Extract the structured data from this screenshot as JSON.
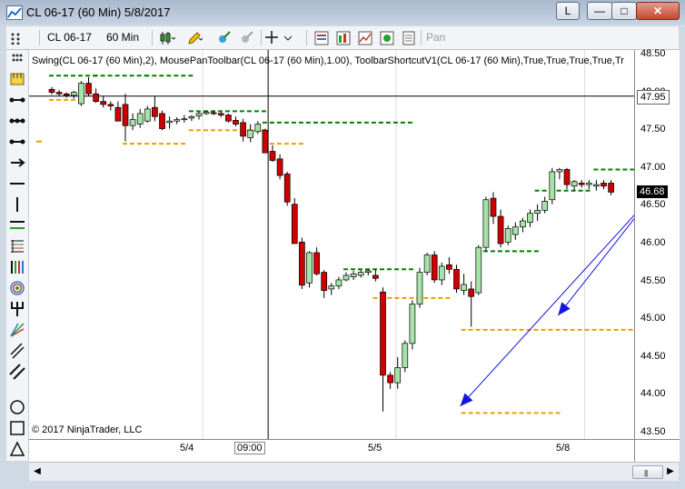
{
  "window": {
    "title": "CL 06-17 (60 Min)  5/8/2017",
    "link_button": "L",
    "minimize_button": "—",
    "maximize_button": "□",
    "close_button": "✕"
  },
  "toolbar": {
    "instrument": "CL 06-17",
    "period": "60 Min",
    "pan_label": "Pan",
    "icons": [
      "grip-icon",
      "candlestick-style-icon",
      "pencil-icon",
      "crosshair-icon",
      "zoom-icon",
      "properties-icon",
      "bar-chart-icon",
      "line-chart-icon",
      "data-box-icon",
      "templates-icon"
    ]
  },
  "drawing_tools": [
    "ruler-icon",
    "risk-reward-icon",
    "price-range-icon",
    "time-range-icon",
    "arrow-line-icon",
    "horizontal-line-icon",
    "vertical-line-icon",
    "extended-line-icon",
    "fibonacci-retracement-icon",
    "fibonacci-extension-icon",
    "fibonacci-circle-icon",
    "andrews-pitchfork-icon",
    "gann-fan-icon",
    "regression-channel-icon",
    "trend-channel-icon",
    "ellipse-icon",
    "rectangle-icon",
    "triangle-icon"
  ],
  "chart": {
    "indicator_label": "Swing(CL 06-17 (60 Min),2), MousePanToolbar(CL 06-17 (60 Min),1.00), ToolbarShortcutV1(CL 06-17 (60 Min),True,True,True,True,Tr",
    "copyright": "© 2017 NinjaTrader, LLC",
    "crosshair_price": "47.95",
    "last_price": "46.68",
    "crosshair_time": "09:00",
    "colors": {
      "up": "#a6e3a6",
      "down": "#cc0000",
      "swing_high": "#008000",
      "swing_low": "#e8a000",
      "arrow": "#1414e0"
    }
  },
  "y_axis": {
    "ticks": [
      "48.50",
      "48.00",
      "47.50",
      "47.00",
      "46.50",
      "46.00",
      "45.50",
      "45.00",
      "44.50",
      "44.00",
      "43.50"
    ],
    "min": 43.5,
    "max": 48.5
  },
  "x_axis": {
    "labels": [
      "5/4",
      "5/5",
      "5/8"
    ]
  },
  "chart_data": {
    "type": "candlestick",
    "series": [
      {
        "name": "CL 06-17 (60 Min)",
        "ohlc": [
          [
            48.04,
            48.07,
            47.97,
            48.0
          ],
          [
            48.0,
            48.03,
            47.95,
            47.98
          ],
          [
            47.98,
            48.0,
            47.93,
            47.96
          ],
          [
            47.96,
            48.02,
            47.92,
            48.0
          ],
          [
            47.85,
            48.15,
            47.82,
            48.12
          ],
          [
            48.12,
            48.2,
            47.95,
            47.98
          ],
          [
            47.98,
            48.05,
            47.86,
            47.88
          ],
          [
            47.88,
            47.95,
            47.8,
            47.84
          ],
          [
            47.84,
            47.88,
            47.76,
            47.82
          ],
          [
            47.8,
            47.88,
            47.7,
            47.62
          ],
          [
            47.84,
            47.98,
            47.35,
            47.56
          ],
          [
            47.56,
            47.72,
            47.5,
            47.64
          ],
          [
            47.58,
            47.78,
            47.53,
            47.72
          ],
          [
            47.62,
            47.82,
            47.6,
            47.78
          ],
          [
            47.8,
            47.95,
            47.62,
            47.68
          ],
          [
            47.72,
            47.76,
            47.5,
            47.52
          ],
          [
            47.6,
            47.68,
            47.52,
            47.62
          ],
          [
            47.62,
            47.67,
            47.58,
            47.64
          ],
          [
            47.64,
            47.7,
            47.6,
            47.65
          ],
          [
            47.66,
            47.7,
            47.62,
            47.68
          ],
          [
            47.69,
            47.74,
            47.64,
            47.72
          ],
          [
            47.72,
            47.76,
            47.7,
            47.74
          ],
          [
            47.73,
            47.76,
            47.7,
            47.72
          ],
          [
            47.72,
            47.74,
            47.67,
            47.7
          ],
          [
            47.7,
            47.72,
            47.6,
            47.62
          ],
          [
            47.63,
            47.68,
            47.55,
            47.58
          ],
          [
            47.6,
            47.65,
            47.35,
            47.42
          ],
          [
            47.4,
            47.58,
            47.34,
            47.5
          ],
          [
            47.48,
            47.62,
            47.45,
            47.58
          ],
          [
            47.5,
            47.52,
            47.2,
            47.2
          ],
          [
            47.22,
            47.3,
            47.08,
            47.1
          ],
          [
            47.12,
            47.18,
            46.85,
            46.9
          ],
          [
            46.92,
            46.95,
            46.5,
            46.55
          ],
          [
            46.52,
            46.6,
            46.0,
            46.0
          ],
          [
            46.02,
            46.08,
            45.4,
            45.45
          ],
          [
            45.48,
            45.9,
            45.42,
            45.88
          ],
          [
            45.88,
            45.95,
            45.58,
            45.6
          ],
          [
            45.62,
            45.65,
            45.28,
            45.38
          ],
          [
            45.4,
            45.48,
            45.32,
            45.44
          ],
          [
            45.44,
            45.56,
            45.4,
            45.52
          ],
          [
            45.52,
            45.62,
            45.5,
            45.58
          ],
          [
            45.56,
            45.64,
            45.52,
            45.6
          ],
          [
            45.58,
            45.65,
            45.55,
            45.62
          ],
          [
            45.62,
            45.66,
            45.58,
            45.64
          ],
          [
            45.58,
            45.66,
            45.5,
            45.54
          ],
          [
            45.36,
            45.42,
            43.78,
            44.26
          ],
          [
            44.26,
            44.3,
            44.08,
            44.16
          ],
          [
            44.16,
            44.5,
            44.08,
            44.36
          ],
          [
            44.36,
            44.72,
            44.3,
            44.68
          ],
          [
            44.68,
            45.25,
            44.6,
            45.2
          ],
          [
            45.2,
            45.68,
            45.15,
            45.62
          ],
          [
            45.62,
            45.88,
            45.58,
            45.85
          ],
          [
            45.85,
            45.9,
            45.48,
            45.52
          ],
          [
            45.52,
            45.75,
            45.45,
            45.7
          ],
          [
            45.72,
            45.82,
            45.6,
            45.66
          ],
          [
            45.66,
            45.72,
            45.35,
            45.4
          ],
          [
            45.38,
            45.6,
            45.32,
            45.46
          ],
          [
            45.4,
            45.5,
            44.9,
            45.3
          ],
          [
            45.35,
            45.98,
            45.32,
            45.95
          ],
          [
            45.95,
            46.62,
            45.9,
            46.58
          ],
          [
            46.6,
            46.68,
            46.26,
            46.36
          ],
          [
            46.36,
            46.45,
            45.95,
            46.0
          ],
          [
            46.02,
            46.24,
            45.98,
            46.2
          ],
          [
            46.12,
            46.28,
            46.05,
            46.22
          ],
          [
            46.22,
            46.34,
            46.15,
            46.3
          ],
          [
            46.28,
            46.45,
            46.22,
            46.4
          ],
          [
            46.4,
            46.52,
            46.3,
            46.44
          ],
          [
            46.44,
            46.62,
            46.4,
            46.56
          ],
          [
            46.58,
            47.0,
            46.52,
            46.95
          ],
          [
            46.95,
            47.0,
            46.85,
            46.98
          ],
          [
            46.98,
            47.0,
            46.72,
            46.78
          ],
          [
            46.76,
            46.84,
            46.7,
            46.82
          ],
          [
            46.8,
            46.84,
            46.74,
            46.78
          ],
          [
            46.78,
            46.84,
            46.72,
            46.8
          ],
          [
            46.76,
            46.84,
            46.7,
            46.78
          ],
          [
            46.8,
            46.84,
            46.72,
            46.76
          ],
          [
            46.8,
            46.84,
            46.64,
            46.68
          ]
        ]
      }
    ],
    "swing_highs": [
      [
        0,
        6,
        48.22
      ],
      [
        6,
        13,
        48.22
      ],
      [
        13,
        19,
        48.22
      ],
      [
        19,
        29,
        47.75
      ],
      [
        29,
        49,
        47.6
      ],
      [
        40,
        49,
        45.66
      ],
      [
        59,
        66,
        45.9
      ],
      [
        66,
        73,
        46.7
      ],
      [
        74,
        79,
        46.98
      ]
    ],
    "swing_lows": [
      [
        0,
        4,
        47.9
      ],
      [
        10,
        18,
        47.32
      ],
      [
        19,
        29,
        47.5
      ],
      [
        29,
        34,
        47.32
      ],
      [
        44,
        54,
        45.28
      ],
      [
        56,
        69,
        43.76
      ],
      [
        56,
        83,
        44.86
      ]
    ],
    "ylim": [
      43.5,
      48.5
    ]
  }
}
